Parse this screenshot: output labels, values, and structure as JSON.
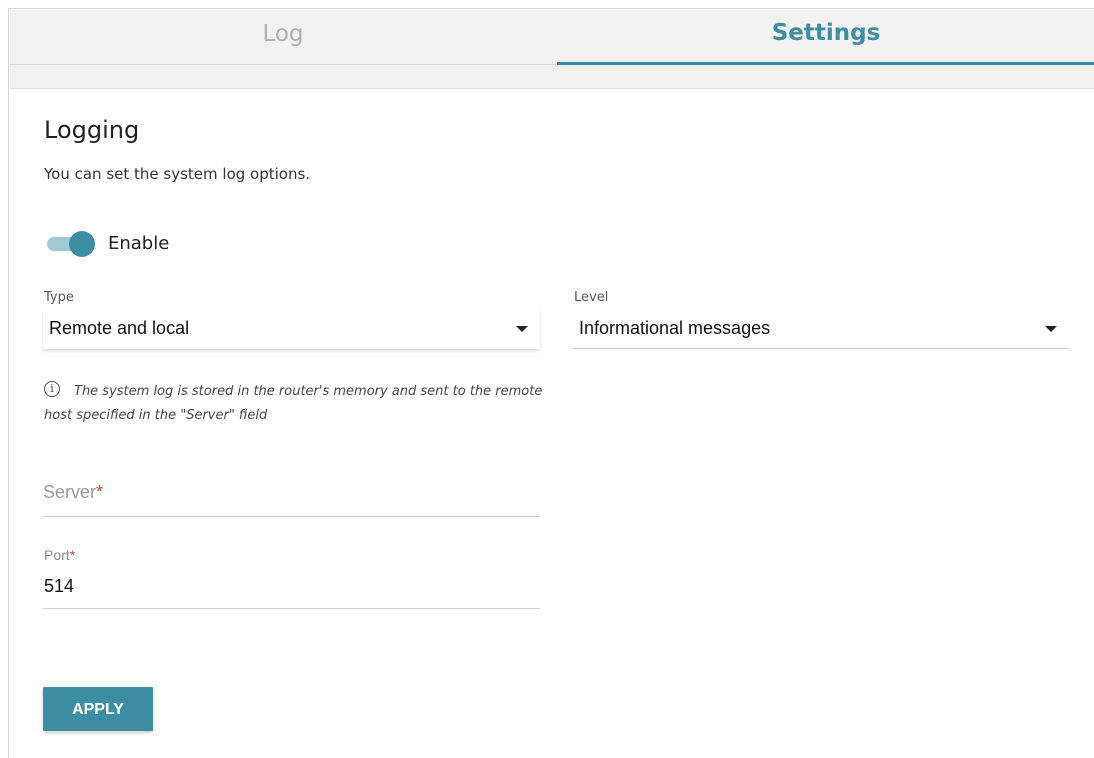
{
  "tabs": {
    "log": "Log",
    "settings": "Settings",
    "active": "Settings"
  },
  "section": {
    "title": "Logging",
    "subtitle": "You can set the system log options."
  },
  "enable": {
    "label": "Enable",
    "on": true
  },
  "type": {
    "label": "Type",
    "value": "Remote and local"
  },
  "level": {
    "label": "Level",
    "value": "Informational messages"
  },
  "info": {
    "icon": "info-icon",
    "glyph": "i",
    "text": "The system log is stored in the router's memory and sent to the remote host specified in the \"Server\" field"
  },
  "server": {
    "placeholder": "Server",
    "required_mark": "*",
    "value": ""
  },
  "port": {
    "label": "Port",
    "required_mark": "*",
    "value": "514"
  },
  "apply_label": "APPLY",
  "colors": {
    "accent": "#3d8ea3",
    "required": "#d9412c"
  }
}
